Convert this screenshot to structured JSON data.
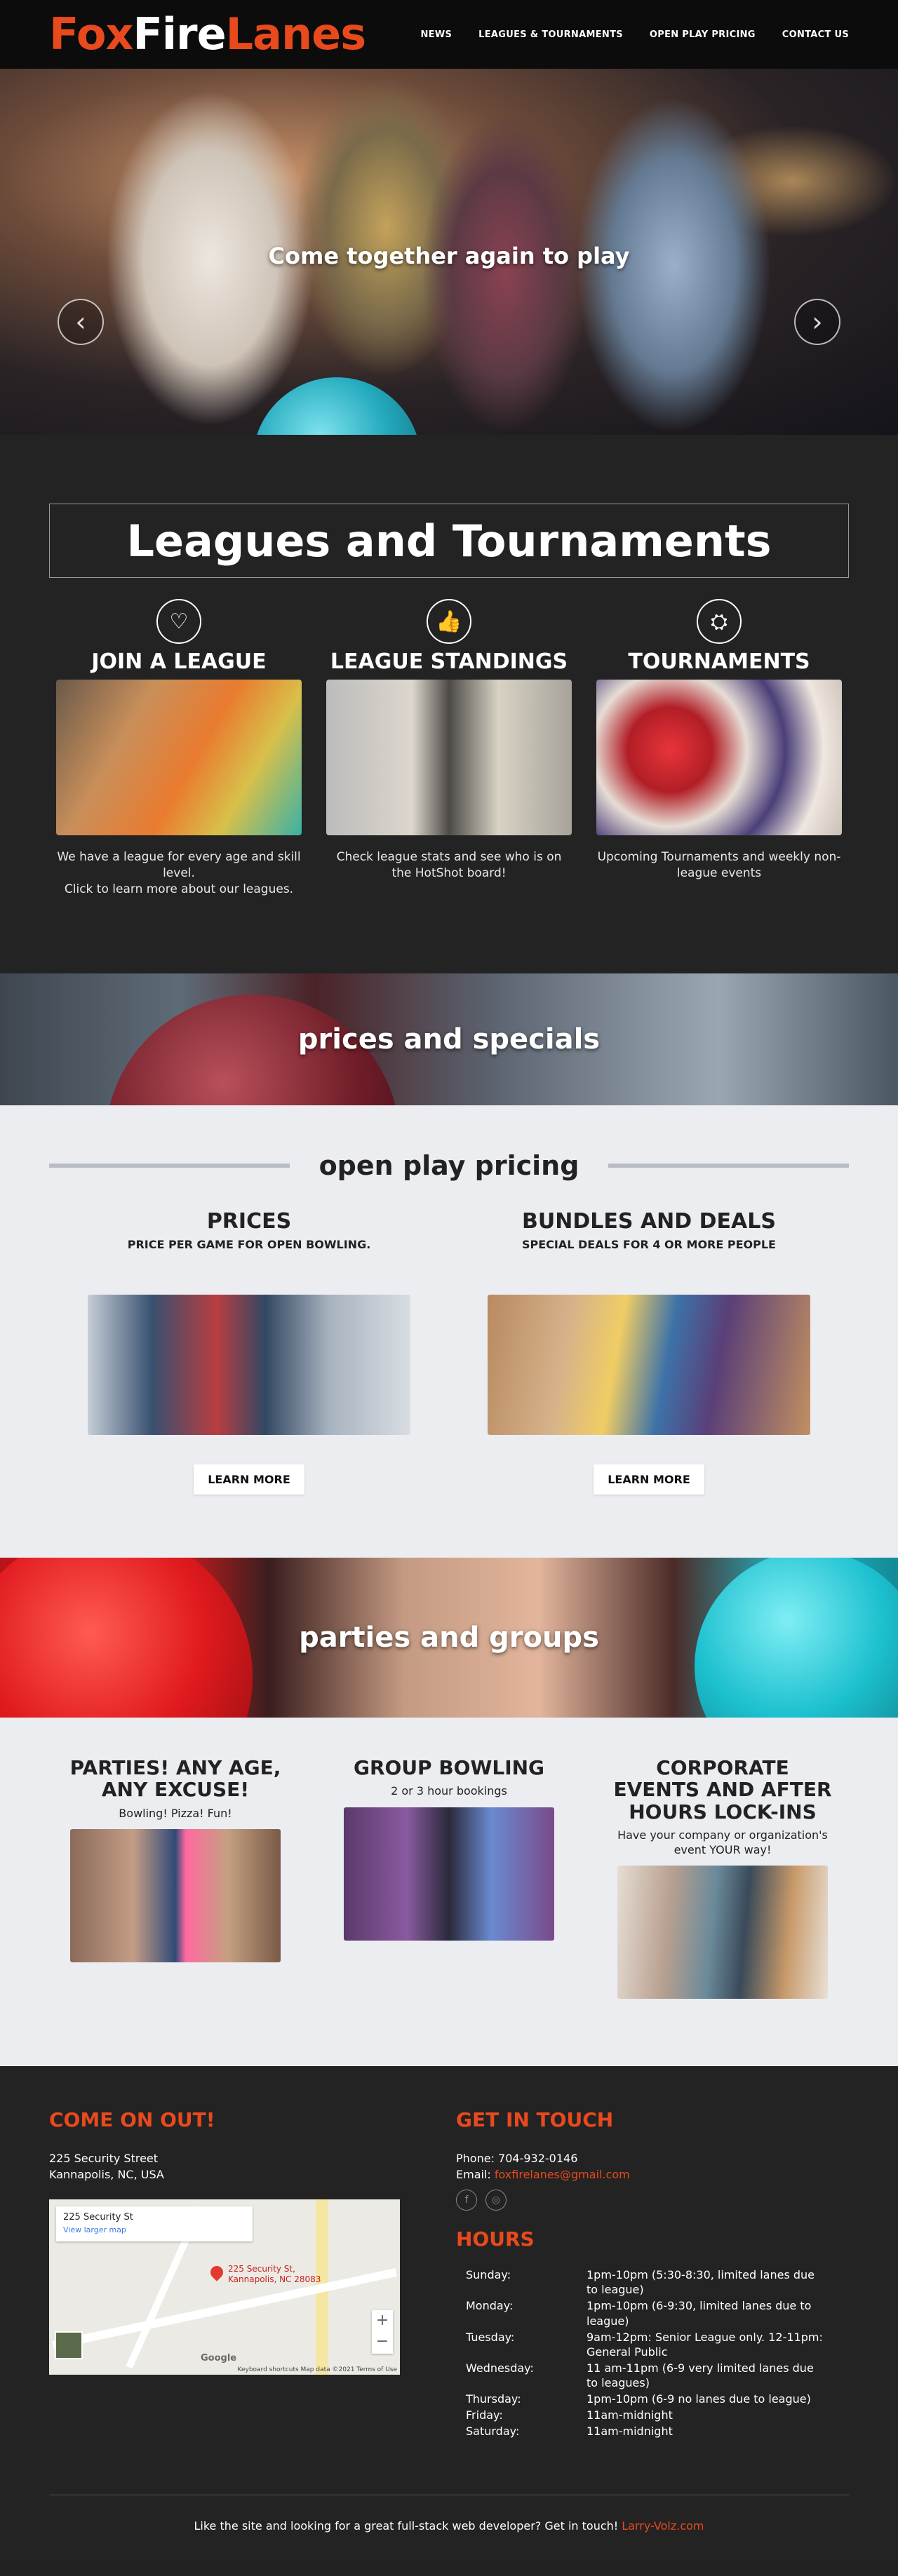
{
  "header": {
    "logo": {
      "part1": "Fox",
      "part2": "Fire",
      "part3": "Lanes"
    },
    "nav": [
      "NEWS",
      "LEAGUES & TOURNAMENTS",
      "OPEN PLAY PRICING",
      "CONTACT US"
    ]
  },
  "hero": {
    "title": "Come together again to play",
    "prev_icon": "‹",
    "next_icon": "›"
  },
  "leagues": {
    "title": "Leagues and Tournaments",
    "cards": [
      {
        "icon": "♡",
        "icon_name": "heart-icon",
        "title": "JOIN A LEAGUE",
        "text1": "We have a league for every age and skill level.",
        "text2": "Click to learn more about our leagues."
      },
      {
        "icon": "👍",
        "icon_name": "thumbs-up-icon",
        "title": "LEAGUE STANDINGS",
        "text1": "Check league stats and see who is on the HotShot board!",
        "text2": ""
      },
      {
        "icon": "⛭",
        "icon_name": "life-ring-icon",
        "title": "TOURNAMENTS",
        "text1": "Upcoming Tournaments and weekly non-league events",
        "text2": ""
      }
    ]
  },
  "prices_banner": {
    "title": "prices and specials"
  },
  "open_play": {
    "title": "open play pricing",
    "columns": [
      {
        "title": "PRICES",
        "subtitle": "PRICE PER GAME FOR OPEN BOWLING.",
        "button": "LEARN MORE"
      },
      {
        "title": "BUNDLES AND DEALS",
        "subtitle": "SPECIAL DEALS FOR 4 OR MORE PEOPLE",
        "button": "LEARN MORE"
      }
    ]
  },
  "parties_banner": {
    "title": "parties and groups"
  },
  "groups": {
    "columns": [
      {
        "title": "PARTIES! ANY AGE, ANY EXCUSE!",
        "text": "Bowling! Pizza! Fun!"
      },
      {
        "title": "GROUP BOWLING",
        "text": "2 or 3 hour bookings"
      },
      {
        "title": "CORPORATE EVENTS AND AFTER HOURS LOCK-INS",
        "text": "Have your company or organization's event YOUR way!"
      }
    ]
  },
  "footer": {
    "come_title": "COME ON OUT!",
    "address1": "225 Security Street",
    "address2": "Kannapolis, NC, USA",
    "map": {
      "box_title": "225 Security St",
      "box_link": "View larger map",
      "pin_label1": "225 Security St,",
      "pin_label2": "Kannapolis, NC 28083",
      "google": "Google",
      "attribution": "Keyboard shortcuts   Map data ©2021   Terms of Use",
      "zoom_in": "+",
      "zoom_out": "−"
    },
    "touch_title": "GET IN TOUCH",
    "phone": "Phone: 704-932-0146",
    "email_label": "Email: ",
    "email": "foxfirelanes@gmail.com",
    "social_icons": [
      "f",
      "◎"
    ],
    "hours_title": "HOURS",
    "hours": [
      {
        "day": "Sunday:",
        "time": "1pm-10pm (5:30-8:30, limited lanes due to league)"
      },
      {
        "day": "Monday:",
        "time": "1pm-10pm (6-9:30, limited lanes due to league)"
      },
      {
        "day": "Tuesday:",
        "time": "9am-12pm: Senior League only. 12-11pm: General Public"
      },
      {
        "day": "Wednesday:",
        "time": "11 am-11pm (6-9 very limited lanes due to leagues)"
      },
      {
        "day": "Thursday:",
        "time": "1pm-10pm (6-9 no lanes due to league)"
      },
      {
        "day": "Friday:",
        "time": "11am-midnight"
      },
      {
        "day": "Saturday:",
        "time": "11am-midnight"
      }
    ],
    "credit": "Like the site and looking for a great full-stack web developer? Get in touch! ",
    "credit_link": "Larry-Volz.com"
  }
}
